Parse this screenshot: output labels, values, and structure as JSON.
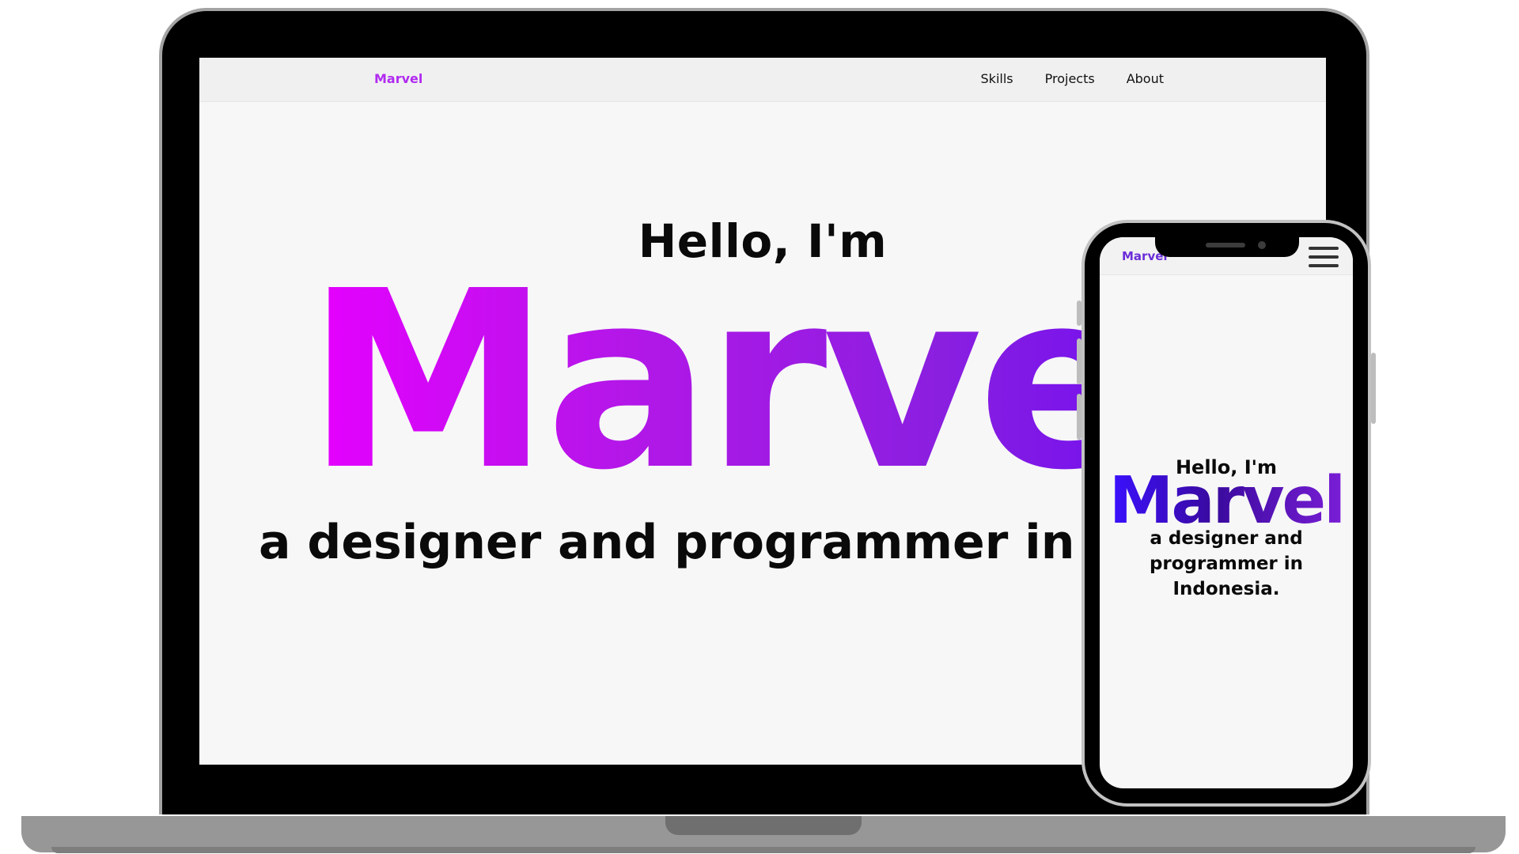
{
  "laptop": {
    "nav": {
      "brand": "Marvel",
      "links": [
        "Skills",
        "Projects",
        "About"
      ]
    },
    "hero": {
      "greeting": "Hello, I'm",
      "name": "Marvel",
      "tagline": "a designer and programmer in Indonesia."
    }
  },
  "phone": {
    "nav": {
      "brand": "Marvel",
      "menu_icon": "hamburger-menu-icon"
    },
    "hero": {
      "greeting": "Hello, I'm",
      "name": "Marvel",
      "tagline": "a designer and programmer in Indonesia."
    }
  },
  "colors": {
    "brand_laptop": "#b12bf0",
    "brand_phone": "#6b2ed9",
    "gradient_laptop": [
      "#e600ff",
      "#6a0af5"
    ],
    "gradient_phone": [
      "#3a10ff",
      "#7a1ed6"
    ]
  }
}
